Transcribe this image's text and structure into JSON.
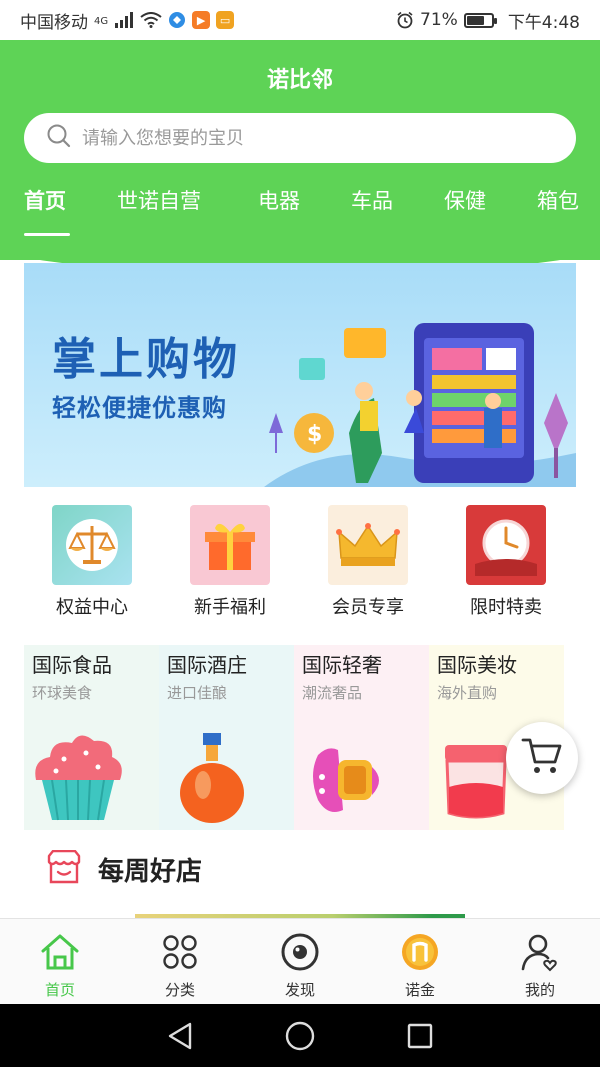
{
  "status_bar": {
    "carrier": "中国移动",
    "network": "4G",
    "battery": "71%",
    "battery_level": 0.71,
    "time": "下午4:48",
    "icons": [
      "signal-icon",
      "wifi-icon",
      "browser-icon",
      "video-app-icon",
      "tv-app-icon",
      "alarm-icon",
      "battery-icon"
    ]
  },
  "header": {
    "title": "诺比邻",
    "search_placeholder": "请输入您想要的宝贝",
    "bg_color": "#5ed356"
  },
  "tabs": [
    {
      "label": "首页",
      "active": true
    },
    {
      "label": "世诺自营",
      "active": false
    },
    {
      "label": "电器",
      "active": false
    },
    {
      "label": "车品",
      "active": false
    },
    {
      "label": "保健",
      "active": false
    },
    {
      "label": "箱包",
      "active": false
    }
  ],
  "banner": {
    "title": "掌上购物",
    "subtitle": "轻松便捷优惠购",
    "title_color": "#1e60b4"
  },
  "quick_links": [
    {
      "label": "权益中心",
      "icon": "scale-icon"
    },
    {
      "label": "新手福利",
      "icon": "gift-icon"
    },
    {
      "label": "会员专享",
      "icon": "crown-icon"
    },
    {
      "label": "限时特卖",
      "icon": "clock-icon"
    }
  ],
  "international": [
    {
      "title": "国际食品",
      "subtitle": "环球美食",
      "icon": "cupcake-icon",
      "bg": "#eef8f3"
    },
    {
      "title": "国际酒庄",
      "subtitle": "进口佳酿",
      "icon": "wine-bottle-icon",
      "bg": "#eaf7f7"
    },
    {
      "title": "国际轻奢",
      "subtitle": "潮流奢品",
      "icon": "watch-icon",
      "bg": "#fdf0f4"
    },
    {
      "title": "国际美妆",
      "subtitle": "海外直购",
      "icon": "cream-jar-icon",
      "bg": "#fdfbe9"
    }
  ],
  "weekly": {
    "title": "每周好店",
    "icon": "store-icon"
  },
  "bottom_nav": [
    {
      "label": "首页",
      "icon": "home-icon",
      "active": true
    },
    {
      "label": "分类",
      "icon": "grid-icon",
      "active": false
    },
    {
      "label": "发现",
      "icon": "discover-icon",
      "active": false
    },
    {
      "label": "诺金",
      "icon": "coin-icon",
      "active": false
    },
    {
      "label": "我的",
      "icon": "user-icon",
      "active": false
    }
  ],
  "system_nav": [
    "back-icon",
    "home-circle-icon",
    "recents-icon"
  ],
  "colors": {
    "accent_green": "#47c74a",
    "cart_icon": "#333333"
  }
}
